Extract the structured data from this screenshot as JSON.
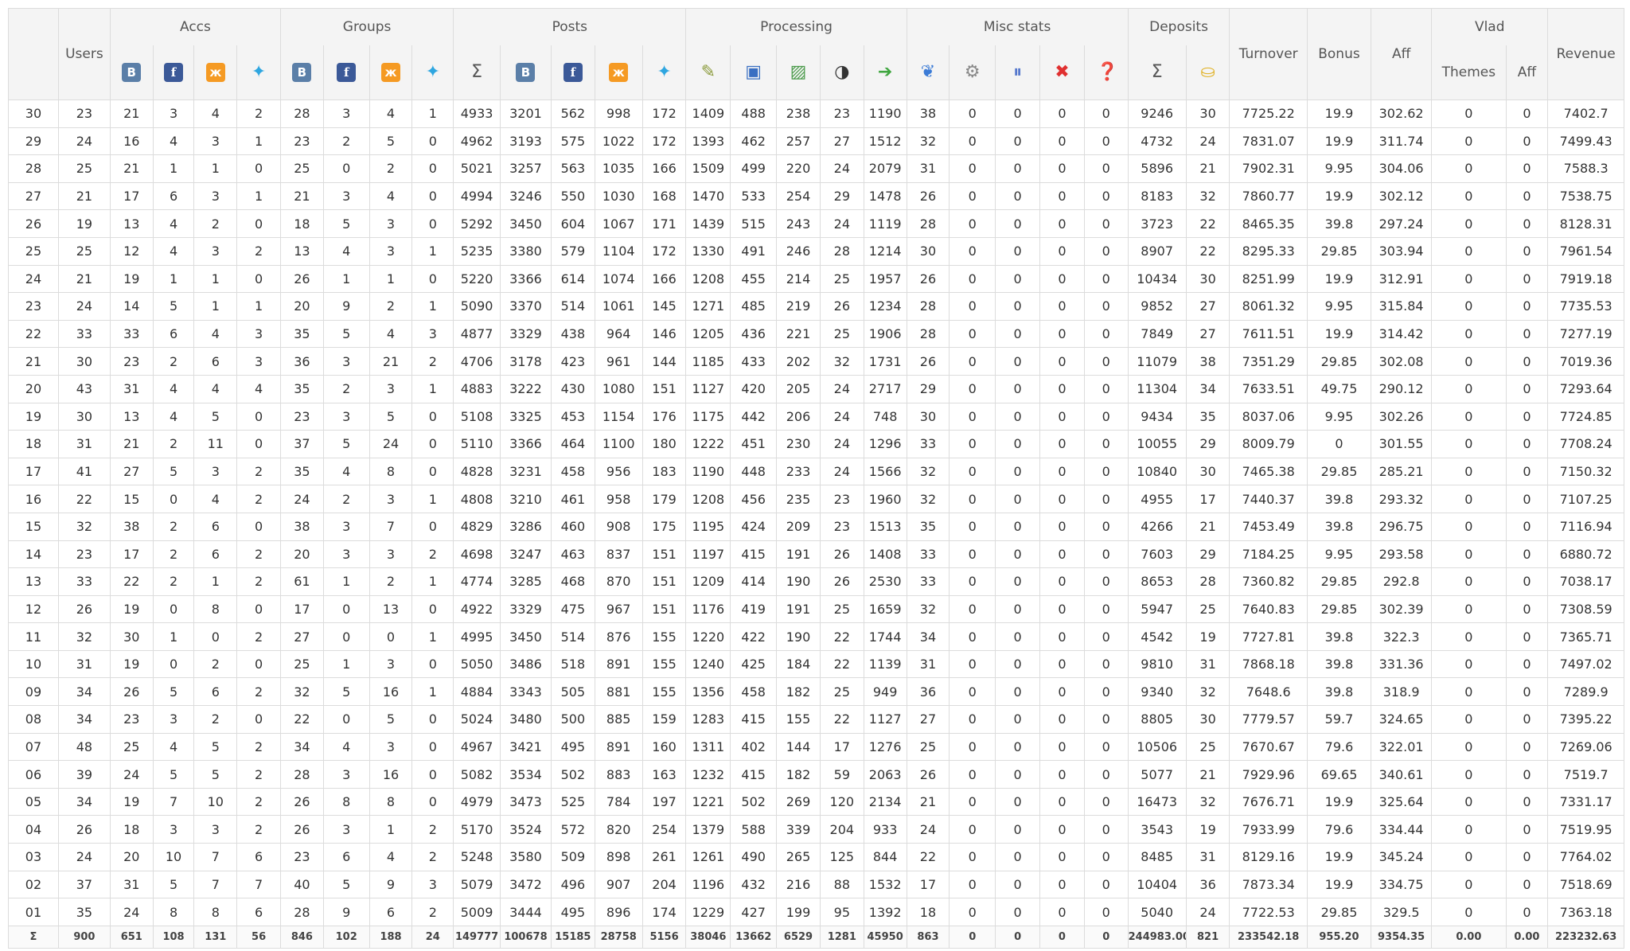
{
  "header": {
    "users": "Users",
    "groups": [
      {
        "label": "Accs",
        "span": 4
      },
      {
        "label": "Groups",
        "span": 4
      },
      {
        "label": "Posts",
        "span": 5
      },
      {
        "label": "Processing",
        "span": 5
      },
      {
        "label": "Misc stats",
        "span": 5
      },
      {
        "label": "Deposits",
        "span": 2
      }
    ],
    "turnover": "Turnover",
    "bonus": "Bonus",
    "aff": "Aff",
    "vlad": "Vlad",
    "vlad_themes": "Themes",
    "vlad_aff": "Aff",
    "revenue": "Revenue",
    "icons": [
      {
        "name": "vk-icon",
        "glyph": "B",
        "cls": "ic-vk",
        "color": "#5b7fa8"
      },
      {
        "name": "facebook-icon",
        "glyph": "f",
        "cls": "ic-fb",
        "color": "#3b5998"
      },
      {
        "name": "odnoklassniki-icon",
        "glyph": "ж",
        "cls": "ic-ok",
        "color": "#f59a23"
      },
      {
        "name": "twitter-icon",
        "glyph": "✦",
        "cls": "ic-tw",
        "color": "#2ea6e0"
      },
      {
        "name": "vk-icon",
        "glyph": "B",
        "cls": "ic-vk",
        "color": "#5b7fa8"
      },
      {
        "name": "facebook-icon",
        "glyph": "f",
        "cls": "ic-fb",
        "color": "#3b5998"
      },
      {
        "name": "odnoklassniki-icon",
        "glyph": "ж",
        "cls": "ic-ok",
        "color": "#f59a23"
      },
      {
        "name": "twitter-icon",
        "glyph": "✦",
        "cls": "ic-tw",
        "color": "#2ea6e0"
      },
      {
        "name": "sum-icon",
        "glyph": "Σ",
        "cls": "ic-sum",
        "color": "#555555"
      },
      {
        "name": "vk-icon",
        "glyph": "B",
        "cls": "ic-vk",
        "color": "#5b7fa8"
      },
      {
        "name": "facebook-icon",
        "glyph": "f",
        "cls": "ic-fb",
        "color": "#3b5998"
      },
      {
        "name": "odnoklassniki-icon",
        "glyph": "ж",
        "cls": "ic-ok",
        "color": "#f59a23"
      },
      {
        "name": "twitter-icon",
        "glyph": "✦",
        "cls": "ic-tw",
        "color": "#2ea6e0"
      },
      {
        "name": "edit-icon",
        "glyph": "✎",
        "cls": "ic-plain",
        "color": "#8a9a3a"
      },
      {
        "name": "crop-icon",
        "glyph": "▣",
        "cls": "ic-plain",
        "color": "#3a6fc2"
      },
      {
        "name": "image-icon",
        "glyph": "▨",
        "cls": "ic-plain",
        "color": "#4a9a4a"
      },
      {
        "name": "contrast-icon",
        "glyph": "◑",
        "cls": "ic-plain",
        "color": "#333333"
      },
      {
        "name": "arrow-right-icon",
        "glyph": "➔",
        "cls": "ic-plain",
        "color": "#3fa63f"
      },
      {
        "name": "translate-icon",
        "glyph": "❦",
        "cls": "ic-plain",
        "color": "#3b7bd6"
      },
      {
        "name": "gear-icon",
        "glyph": "⚙",
        "cls": "ic-plain",
        "color": "#888888"
      },
      {
        "name": "pause-icon",
        "glyph": "⏸",
        "cls": "ic-plain",
        "color": "#5577cc"
      },
      {
        "name": "close-icon",
        "glyph": "✖",
        "cls": "ic-plain",
        "color": "#e03030"
      },
      {
        "name": "help-icon",
        "glyph": "❓",
        "cls": "ic-plain",
        "color": "#3a6fc2"
      },
      {
        "name": "sum-icon",
        "glyph": "Σ",
        "cls": "ic-sum",
        "color": "#555555"
      },
      {
        "name": "coins-icon",
        "glyph": "⛀",
        "cls": "ic-plain",
        "color": "#e0b020"
      }
    ]
  },
  "rows": [
    [
      "30",
      "23",
      "21",
      "3",
      "4",
      "2",
      "28",
      "3",
      "4",
      "1",
      "4933",
      "3201",
      "562",
      "998",
      "172",
      "1409",
      "488",
      "238",
      "23",
      "1190",
      "38",
      "0",
      "0",
      "0",
      "0",
      "9246",
      "30",
      "7725.22",
      "19.9",
      "302.62",
      "0",
      "0",
      "7402.7"
    ],
    [
      "29",
      "24",
      "16",
      "4",
      "3",
      "1",
      "23",
      "2",
      "5",
      "0",
      "4962",
      "3193",
      "575",
      "1022",
      "172",
      "1393",
      "462",
      "257",
      "27",
      "1512",
      "32",
      "0",
      "0",
      "0",
      "0",
      "4732",
      "24",
      "7831.07",
      "19.9",
      "311.74",
      "0",
      "0",
      "7499.43"
    ],
    [
      "28",
      "25",
      "21",
      "1",
      "1",
      "0",
      "25",
      "0",
      "2",
      "0",
      "5021",
      "3257",
      "563",
      "1035",
      "166",
      "1509",
      "499",
      "220",
      "24",
      "2079",
      "31",
      "0",
      "0",
      "0",
      "0",
      "5896",
      "21",
      "7902.31",
      "9.95",
      "304.06",
      "0",
      "0",
      "7588.3"
    ],
    [
      "27",
      "21",
      "17",
      "6",
      "3",
      "1",
      "21",
      "3",
      "4",
      "0",
      "4994",
      "3246",
      "550",
      "1030",
      "168",
      "1470",
      "533",
      "254",
      "29",
      "1478",
      "26",
      "0",
      "0",
      "0",
      "0",
      "8183",
      "32",
      "7860.77",
      "19.9",
      "302.12",
      "0",
      "0",
      "7538.75"
    ],
    [
      "26",
      "19",
      "13",
      "4",
      "2",
      "0",
      "18",
      "5",
      "3",
      "0",
      "5292",
      "3450",
      "604",
      "1067",
      "171",
      "1439",
      "515",
      "243",
      "24",
      "1119",
      "28",
      "0",
      "0",
      "0",
      "0",
      "3723",
      "22",
      "8465.35",
      "39.8",
      "297.24",
      "0",
      "0",
      "8128.31"
    ],
    [
      "25",
      "25",
      "12",
      "4",
      "3",
      "2",
      "13",
      "4",
      "3",
      "1",
      "5235",
      "3380",
      "579",
      "1104",
      "172",
      "1330",
      "491",
      "246",
      "28",
      "1214",
      "30",
      "0",
      "0",
      "0",
      "0",
      "8907",
      "22",
      "8295.33",
      "29.85",
      "303.94",
      "0",
      "0",
      "7961.54"
    ],
    [
      "24",
      "21",
      "19",
      "1",
      "1",
      "0",
      "26",
      "1",
      "1",
      "0",
      "5220",
      "3366",
      "614",
      "1074",
      "166",
      "1208",
      "455",
      "214",
      "25",
      "1957",
      "26",
      "0",
      "0",
      "0",
      "0",
      "10434",
      "30",
      "8251.99",
      "19.9",
      "312.91",
      "0",
      "0",
      "7919.18"
    ],
    [
      "23",
      "24",
      "14",
      "5",
      "1",
      "1",
      "20",
      "9",
      "2",
      "1",
      "5090",
      "3370",
      "514",
      "1061",
      "145",
      "1271",
      "485",
      "219",
      "26",
      "1234",
      "28",
      "0",
      "0",
      "0",
      "0",
      "9852",
      "27",
      "8061.32",
      "9.95",
      "315.84",
      "0",
      "0",
      "7735.53"
    ],
    [
      "22",
      "33",
      "33",
      "6",
      "4",
      "3",
      "35",
      "5",
      "4",
      "3",
      "4877",
      "3329",
      "438",
      "964",
      "146",
      "1205",
      "436",
      "221",
      "25",
      "1906",
      "28",
      "0",
      "0",
      "0",
      "0",
      "7849",
      "27",
      "7611.51",
      "19.9",
      "314.42",
      "0",
      "0",
      "7277.19"
    ],
    [
      "21",
      "30",
      "23",
      "2",
      "6",
      "3",
      "36",
      "3",
      "21",
      "2",
      "4706",
      "3178",
      "423",
      "961",
      "144",
      "1185",
      "433",
      "202",
      "32",
      "1731",
      "26",
      "0",
      "0",
      "0",
      "0",
      "11079",
      "38",
      "7351.29",
      "29.85",
      "302.08",
      "0",
      "0",
      "7019.36"
    ],
    [
      "20",
      "43",
      "31",
      "4",
      "4",
      "4",
      "35",
      "2",
      "3",
      "1",
      "4883",
      "3222",
      "430",
      "1080",
      "151",
      "1127",
      "420",
      "205",
      "24",
      "2717",
      "29",
      "0",
      "0",
      "0",
      "0",
      "11304",
      "34",
      "7633.51",
      "49.75",
      "290.12",
      "0",
      "0",
      "7293.64"
    ],
    [
      "19",
      "30",
      "13",
      "4",
      "5",
      "0",
      "23",
      "3",
      "5",
      "0",
      "5108",
      "3325",
      "453",
      "1154",
      "176",
      "1175",
      "442",
      "206",
      "24",
      "748",
      "30",
      "0",
      "0",
      "0",
      "0",
      "9434",
      "35",
      "8037.06",
      "9.95",
      "302.26",
      "0",
      "0",
      "7724.85"
    ],
    [
      "18",
      "31",
      "21",
      "2",
      "11",
      "0",
      "37",
      "5",
      "24",
      "0",
      "5110",
      "3366",
      "464",
      "1100",
      "180",
      "1222",
      "451",
      "230",
      "24",
      "1296",
      "33",
      "0",
      "0",
      "0",
      "0",
      "10055",
      "29",
      "8009.79",
      "0",
      "301.55",
      "0",
      "0",
      "7708.24"
    ],
    [
      "17",
      "41",
      "27",
      "5",
      "3",
      "2",
      "35",
      "4",
      "8",
      "0",
      "4828",
      "3231",
      "458",
      "956",
      "183",
      "1190",
      "448",
      "233",
      "24",
      "1566",
      "32",
      "0",
      "0",
      "0",
      "0",
      "10840",
      "30",
      "7465.38",
      "29.85",
      "285.21",
      "0",
      "0",
      "7150.32"
    ],
    [
      "16",
      "22",
      "15",
      "0",
      "4",
      "2",
      "24",
      "2",
      "3",
      "1",
      "4808",
      "3210",
      "461",
      "958",
      "179",
      "1208",
      "456",
      "235",
      "23",
      "1960",
      "32",
      "0",
      "0",
      "0",
      "0",
      "4955",
      "17",
      "7440.37",
      "39.8",
      "293.32",
      "0",
      "0",
      "7107.25"
    ],
    [
      "15",
      "32",
      "38",
      "2",
      "6",
      "0",
      "38",
      "3",
      "7",
      "0",
      "4829",
      "3286",
      "460",
      "908",
      "175",
      "1195",
      "424",
      "209",
      "23",
      "1513",
      "35",
      "0",
      "0",
      "0",
      "0",
      "4266",
      "21",
      "7453.49",
      "39.8",
      "296.75",
      "0",
      "0",
      "7116.94"
    ],
    [
      "14",
      "23",
      "17",
      "2",
      "6",
      "2",
      "20",
      "3",
      "3",
      "2",
      "4698",
      "3247",
      "463",
      "837",
      "151",
      "1197",
      "415",
      "191",
      "26",
      "1408",
      "33",
      "0",
      "0",
      "0",
      "0",
      "7603",
      "29",
      "7184.25",
      "9.95",
      "293.58",
      "0",
      "0",
      "6880.72"
    ],
    [
      "13",
      "33",
      "22",
      "2",
      "1",
      "2",
      "61",
      "1",
      "2",
      "1",
      "4774",
      "3285",
      "468",
      "870",
      "151",
      "1209",
      "414",
      "190",
      "26",
      "2530",
      "33",
      "0",
      "0",
      "0",
      "0",
      "8653",
      "28",
      "7360.82",
      "29.85",
      "292.8",
      "0",
      "0",
      "7038.17"
    ],
    [
      "12",
      "26",
      "19",
      "0",
      "8",
      "0",
      "17",
      "0",
      "13",
      "0",
      "4922",
      "3329",
      "475",
      "967",
      "151",
      "1176",
      "419",
      "191",
      "25",
      "1659",
      "32",
      "0",
      "0",
      "0",
      "0",
      "5947",
      "25",
      "7640.83",
      "29.85",
      "302.39",
      "0",
      "0",
      "7308.59"
    ],
    [
      "11",
      "32",
      "30",
      "1",
      "0",
      "2",
      "27",
      "0",
      "0",
      "1",
      "4995",
      "3450",
      "514",
      "876",
      "155",
      "1220",
      "422",
      "190",
      "22",
      "1744",
      "34",
      "0",
      "0",
      "0",
      "0",
      "4542",
      "19",
      "7727.81",
      "39.8",
      "322.3",
      "0",
      "0",
      "7365.71"
    ],
    [
      "10",
      "31",
      "19",
      "0",
      "2",
      "0",
      "25",
      "1",
      "3",
      "0",
      "5050",
      "3486",
      "518",
      "891",
      "155",
      "1240",
      "425",
      "184",
      "22",
      "1139",
      "31",
      "0",
      "0",
      "0",
      "0",
      "9810",
      "31",
      "7868.18",
      "39.8",
      "331.36",
      "0",
      "0",
      "7497.02"
    ],
    [
      "09",
      "34",
      "26",
      "5",
      "6",
      "2",
      "32",
      "5",
      "16",
      "1",
      "4884",
      "3343",
      "505",
      "881",
      "155",
      "1356",
      "458",
      "182",
      "25",
      "949",
      "36",
      "0",
      "0",
      "0",
      "0",
      "9340",
      "32",
      "7648.6",
      "39.8",
      "318.9",
      "0",
      "0",
      "7289.9"
    ],
    [
      "08",
      "34",
      "23",
      "3",
      "2",
      "0",
      "22",
      "0",
      "5",
      "0",
      "5024",
      "3480",
      "500",
      "885",
      "159",
      "1283",
      "415",
      "155",
      "22",
      "1127",
      "27",
      "0",
      "0",
      "0",
      "0",
      "8805",
      "30",
      "7779.57",
      "59.7",
      "324.65",
      "0",
      "0",
      "7395.22"
    ],
    [
      "07",
      "48",
      "25",
      "4",
      "5",
      "2",
      "34",
      "4",
      "3",
      "0",
      "4967",
      "3421",
      "495",
      "891",
      "160",
      "1311",
      "402",
      "144",
      "17",
      "1276",
      "25",
      "0",
      "0",
      "0",
      "0",
      "10506",
      "25",
      "7670.67",
      "79.6",
      "322.01",
      "0",
      "0",
      "7269.06"
    ],
    [
      "06",
      "39",
      "24",
      "5",
      "5",
      "2",
      "28",
      "3",
      "16",
      "0",
      "5082",
      "3534",
      "502",
      "883",
      "163",
      "1232",
      "415",
      "182",
      "59",
      "2063",
      "26",
      "0",
      "0",
      "0",
      "0",
      "5077",
      "21",
      "7929.96",
      "69.65",
      "340.61",
      "0",
      "0",
      "7519.7"
    ],
    [
      "05",
      "34",
      "19",
      "7",
      "10",
      "2",
      "26",
      "8",
      "8",
      "0",
      "4979",
      "3473",
      "525",
      "784",
      "197",
      "1221",
      "502",
      "269",
      "120",
      "2134",
      "21",
      "0",
      "0",
      "0",
      "0",
      "16473",
      "32",
      "7676.71",
      "19.9",
      "325.64",
      "0",
      "0",
      "7331.17"
    ],
    [
      "04",
      "26",
      "18",
      "3",
      "3",
      "2",
      "26",
      "3",
      "1",
      "2",
      "5170",
      "3524",
      "572",
      "820",
      "254",
      "1379",
      "588",
      "339",
      "204",
      "933",
      "24",
      "0",
      "0",
      "0",
      "0",
      "3543",
      "19",
      "7933.99",
      "79.6",
      "334.44",
      "0",
      "0",
      "7519.95"
    ],
    [
      "03",
      "24",
      "20",
      "10",
      "7",
      "6",
      "23",
      "6",
      "4",
      "2",
      "5248",
      "3580",
      "509",
      "898",
      "261",
      "1261",
      "490",
      "265",
      "125",
      "844",
      "22",
      "0",
      "0",
      "0",
      "0",
      "8485",
      "31",
      "8129.16",
      "19.9",
      "345.24",
      "0",
      "0",
      "7764.02"
    ],
    [
      "02",
      "37",
      "31",
      "5",
      "7",
      "7",
      "40",
      "5",
      "9",
      "3",
      "5079",
      "3472",
      "496",
      "907",
      "204",
      "1196",
      "432",
      "216",
      "88",
      "1532",
      "17",
      "0",
      "0",
      "0",
      "0",
      "10404",
      "36",
      "7873.34",
      "19.9",
      "334.75",
      "0",
      "0",
      "7518.69"
    ],
    [
      "01",
      "35",
      "24",
      "8",
      "8",
      "6",
      "28",
      "9",
      "6",
      "2",
      "5009",
      "3444",
      "495",
      "896",
      "174",
      "1229",
      "427",
      "199",
      "95",
      "1392",
      "18",
      "0",
      "0",
      "0",
      "0",
      "5040",
      "24",
      "7722.53",
      "29.85",
      "329.5",
      "0",
      "0",
      "7363.18"
    ]
  ],
  "totals": [
    "Σ",
    "900",
    "651",
    "108",
    "131",
    "56",
    "846",
    "102",
    "188",
    "24",
    "149777",
    "100678",
    "15185",
    "28758",
    "5156",
    "38046",
    "13662",
    "6529",
    "1281",
    "45950",
    "863",
    "0",
    "0",
    "0",
    "0",
    "244983.00",
    "821",
    "233542.18",
    "955.20",
    "9354.35",
    "0.00",
    "0.00",
    "223232.63"
  ]
}
